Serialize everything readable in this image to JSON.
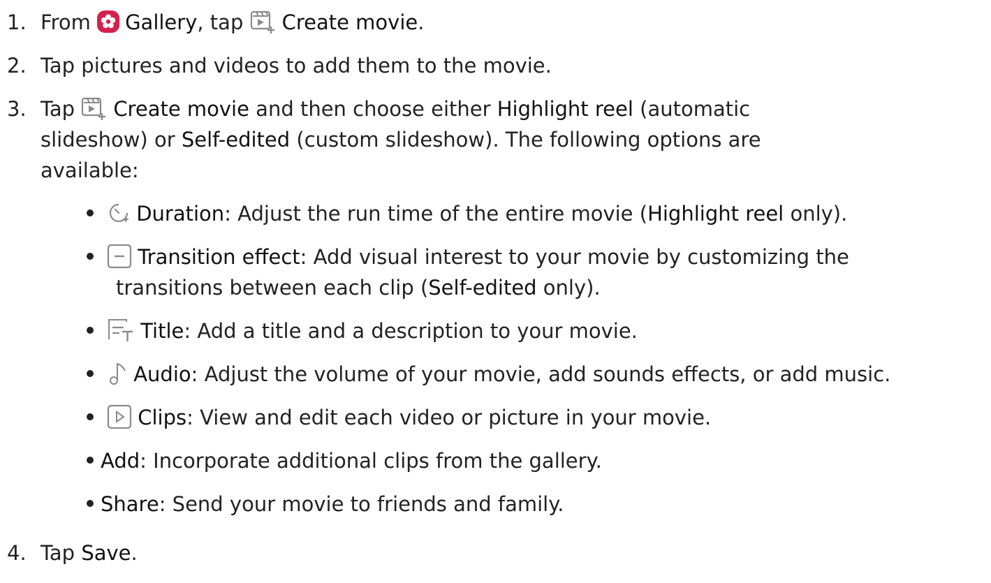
{
  "steps": [
    {
      "num": "1.",
      "parts": {
        "from": "From",
        "gallery": "Gallery",
        "comma_tap": ", tap",
        "create_movie": "Create movie",
        "end": "."
      }
    },
    {
      "num": "2.",
      "text": "Tap pictures and videos to add them to the movie."
    },
    {
      "num": "3.",
      "parts": {
        "tap": "Tap",
        "create_movie": "Create movie",
        "and_choose": " and then choose either ",
        "highlight_reel": "Highlight reel",
        "automatic": " (automatic",
        "line2_start": "slideshow) or ",
        "self_edited": "Self-edited",
        "line2_end": " (custom slideshow). The following options are",
        "line3": "available:"
      }
    },
    {
      "num": "4.",
      "parts": {
        "tap": "Tap ",
        "save": "Save",
        "end": "."
      }
    }
  ],
  "options": [
    {
      "icon": "duration-icon",
      "label": "Duration",
      "text_a": ": Adjust the run time of the entire movie (",
      "ref": "Highlight reel",
      "text_b": " only)."
    },
    {
      "icon": "transition-effect-icon",
      "label": "Transition effect",
      "text_a": ": Add visual interest to your movie by customizing the",
      "line2_a": "transitions between each clip (",
      "ref": "Self-edited",
      "line2_b": " only)."
    },
    {
      "icon": "title-icon",
      "label": "Title",
      "text_a": ": Add a title and a description to your movie."
    },
    {
      "icon": "music-note-icon",
      "label": "Audio",
      "text_a": ": Adjust the volume of your movie, add sounds effects, or add music."
    },
    {
      "icon": "clips-icon",
      "label": "Clips",
      "text_a": ": View and edit each video or picture in your movie."
    },
    {
      "label": "Add",
      "text_a": ": Incorporate additional clips from the gallery."
    },
    {
      "label": "Share",
      "text_a": ": Send your movie to friends and family."
    }
  ],
  "colors": {
    "text": "#222222",
    "gallery_icon_bg": "#d6204f",
    "icon_gray": "#8a8a8a"
  }
}
